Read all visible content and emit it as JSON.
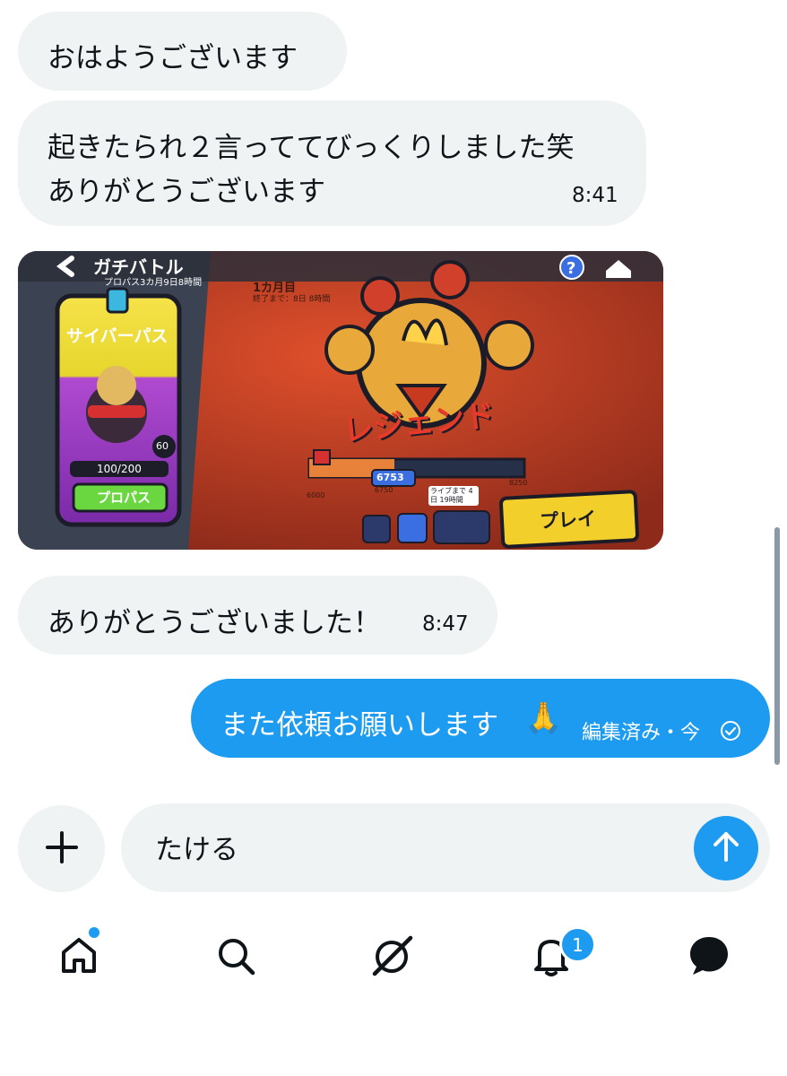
{
  "messages": {
    "m1": {
      "text": "おはようございます"
    },
    "m2": {
      "line1": "起きたられ２言っててびっくりしました笑",
      "line2": "ありがとうございます",
      "time": "8:41"
    },
    "m3": {
      "text": "ありがとうございました！",
      "time": "8:47"
    },
    "m4": {
      "text": "また依頼お願いします",
      "emoji": "🙏",
      "status": "編集済み・今"
    }
  },
  "game_screenshot": {
    "title": "ガチバトル",
    "subtitle": "プロパス3カ月9日8時間",
    "pass_name": "サイバーパス",
    "pass_progress": "100/200",
    "pass_level": "60",
    "pass_button": "プロパス",
    "month_label": "1カ月目",
    "month_sub": "終了まで：8日 8時間",
    "rank": "レジェンド",
    "score": "6753",
    "track_ticks": [
      "6000",
      "6750",
      "8250"
    ],
    "next_reward": "ライブまで 4日 19時間",
    "play_button": "プレイ"
  },
  "composer": {
    "value": "たける",
    "plus_icon": "plus-icon",
    "send_icon": "arrow-up-icon"
  },
  "nav": {
    "items": [
      "home-icon",
      "search-icon",
      "grok-icon",
      "bell-icon",
      "messages-icon"
    ],
    "notification_count": "1"
  },
  "colors": {
    "accent": "#1d9bf0",
    "bubble_in": "#eff3f4"
  }
}
